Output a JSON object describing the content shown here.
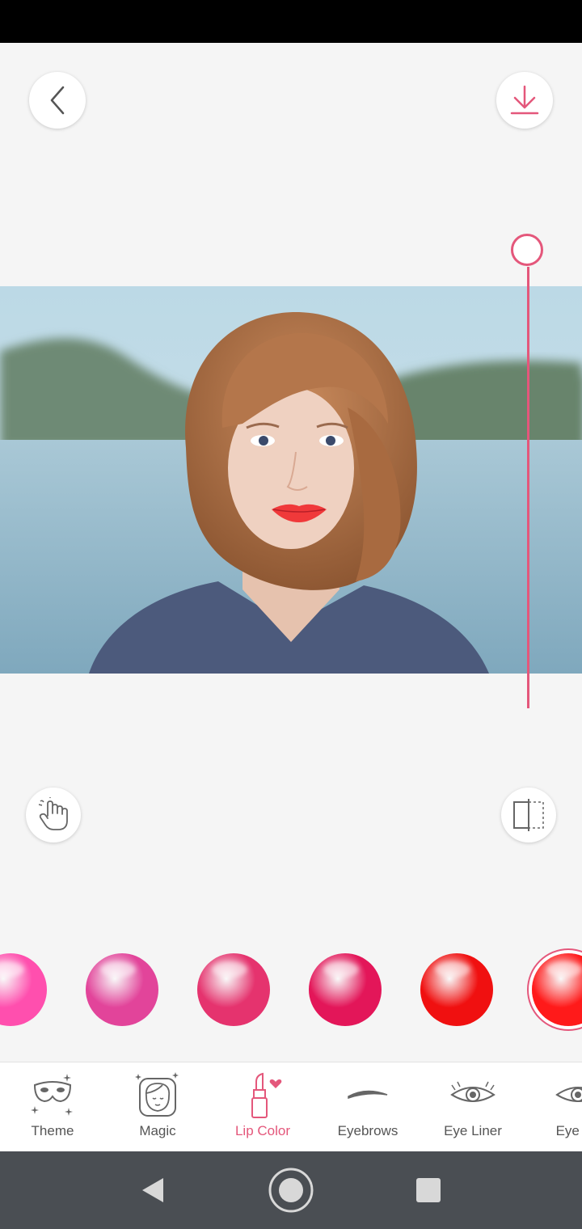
{
  "colors": {
    "accent": "#e4577b",
    "background": "#f5f5f5",
    "nav_bar": "#4a4e53"
  },
  "toolbar": {
    "back_icon": "chevron-left-icon",
    "download_icon": "download-icon",
    "touch_icon": "hand-pointer-icon",
    "compare_icon": "split-compare-icon"
  },
  "slider": {
    "label": "lip-color-intensity",
    "value": 1.0
  },
  "swatches": [
    {
      "color": "#ff4fae"
    },
    {
      "color": "#e2449a"
    },
    {
      "color": "#e5336e"
    },
    {
      "color": "#e31659"
    },
    {
      "color": "#f01010"
    },
    {
      "color": "#ff1a1a",
      "selected": true
    }
  ],
  "tabs": [
    {
      "label": "Theme",
      "icon": "mask-icon"
    },
    {
      "label": "Magic",
      "icon": "magic-face-icon"
    },
    {
      "label": "Lip Color",
      "icon": "lipstick-icon",
      "active": true
    },
    {
      "label": "Eyebrows",
      "icon": "eyebrow-icon"
    },
    {
      "label": "Eye Liner",
      "icon": "eye-icon"
    },
    {
      "label": "Eye Sh",
      "icon": "eye-icon"
    }
  ],
  "system_nav": [
    "back-triangle-icon",
    "home-circle-icon",
    "recents-square-icon"
  ]
}
